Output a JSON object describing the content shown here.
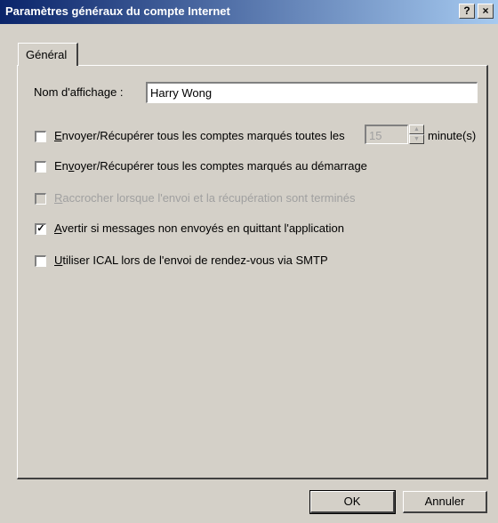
{
  "window": {
    "title": "Paramètres généraux du compte Internet",
    "help_label": "?",
    "close_label": "×"
  },
  "tabs": [
    {
      "label": "Général",
      "selected": true
    }
  ],
  "display_name": {
    "label": "Nom d'affichage :",
    "value": "Harry Wong"
  },
  "options": [
    {
      "prefix": "",
      "accel": "E",
      "rest": "nvoyer/Récupérer tous les comptes marqués toutes les",
      "checked": false,
      "enabled": true
    },
    {
      "prefix": "En",
      "accel": "v",
      "rest": "oyer/Récupérer tous les comptes marqués au démarrage",
      "checked": false,
      "enabled": true
    },
    {
      "prefix": "",
      "accel": "R",
      "rest": "accrocher lorsque l'envoi et la récupération sont terminés",
      "checked": false,
      "enabled": false
    },
    {
      "prefix": "",
      "accel": "A",
      "rest": "vertir si messages non envoyés en quittant l'application",
      "checked": true,
      "enabled": true
    },
    {
      "prefix": "",
      "accel": "U",
      "rest": "tiliser ICAL lors de l'envoi de rendez-vous via SMTP",
      "checked": false,
      "enabled": true
    }
  ],
  "interval": {
    "value": "15",
    "unit": "minute(s)"
  },
  "buttons": {
    "ok": "OK",
    "cancel": "Annuler"
  },
  "colors": {
    "title_start": "#0a246a",
    "title_end": "#a6caf0",
    "face": "#d4d0c8"
  }
}
